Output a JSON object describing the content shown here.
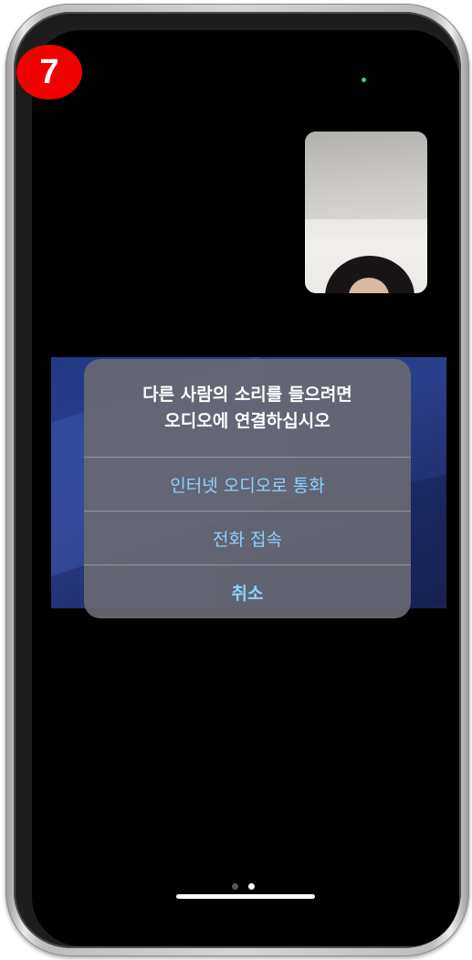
{
  "step_badge": "7",
  "dialog": {
    "message_line1": "다른 사람의 소리를 들으려면",
    "message_line2": "오디오에 연결하십시오",
    "actions": [
      {
        "label": "인터넷 오디오로 통화"
      },
      {
        "label": "전화 접속"
      },
      {
        "label": "취소"
      }
    ]
  },
  "page_indicator": {
    "count": 2,
    "active_index": 1
  },
  "colors": {
    "badge": "#f10000",
    "action_text": "#8dd0ff",
    "camera_indicator": "#3ed26a"
  }
}
